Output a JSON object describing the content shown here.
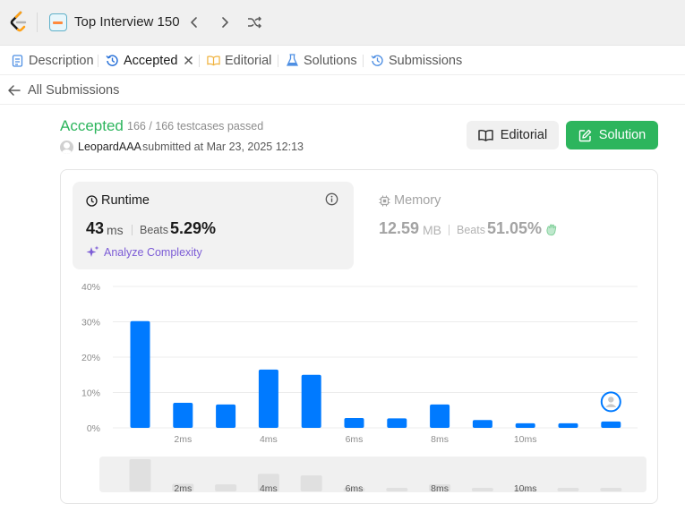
{
  "topbar": {
    "logo_icon": "leetcode-logo-icon",
    "study_plan_title": "Top Interview 150"
  },
  "tabs": [
    {
      "label": "Description",
      "icon": "description-icon"
    },
    {
      "label": "Accepted",
      "icon": "history-icon",
      "active": true
    },
    {
      "label": "Editorial",
      "icon": "book-icon"
    },
    {
      "label": "Solutions",
      "icon": "flask-icon"
    },
    {
      "label": "Submissions",
      "icon": "history-icon"
    }
  ],
  "back": {
    "label": "All Submissions"
  },
  "submission": {
    "status": "Accepted",
    "testcases": "166 / 166 testcases passed",
    "user": "LeopardAAA",
    "submitted_at": "submitted at Mar 23, 2025 12:13"
  },
  "buttons": {
    "editorial": "Editorial",
    "solution": "Solution"
  },
  "runtime": {
    "title": "Runtime",
    "value": "43",
    "unit": "ms",
    "beats_label": "Beats",
    "beats_value": "5.29%",
    "analyze_label": "Analyze Complexity"
  },
  "memory": {
    "title": "Memory",
    "value": "12.59",
    "unit": "MB",
    "beats_label": "Beats",
    "beats_value": "51.05%"
  },
  "colors": {
    "accepted": "#2db55d",
    "bar": "#007aff",
    "analyze": "#7c5cd6"
  },
  "chart_data": {
    "type": "bar",
    "title": "",
    "xlabel": "",
    "ylabel": "",
    "ylim": [
      0,
      40
    ],
    "y_ticks": [
      "0%",
      "10%",
      "20%",
      "30%",
      "40%"
    ],
    "x_tick_labels": [
      "2ms",
      "4ms",
      "6ms",
      "8ms",
      "10ms"
    ],
    "values": [
      30.2,
      7.1,
      6.6,
      16.5,
      15.0,
      2.8,
      2.7,
      6.6,
      2.2,
      1.3,
      1.3,
      1.8
    ],
    "highlight_index": 11,
    "grid": true
  }
}
